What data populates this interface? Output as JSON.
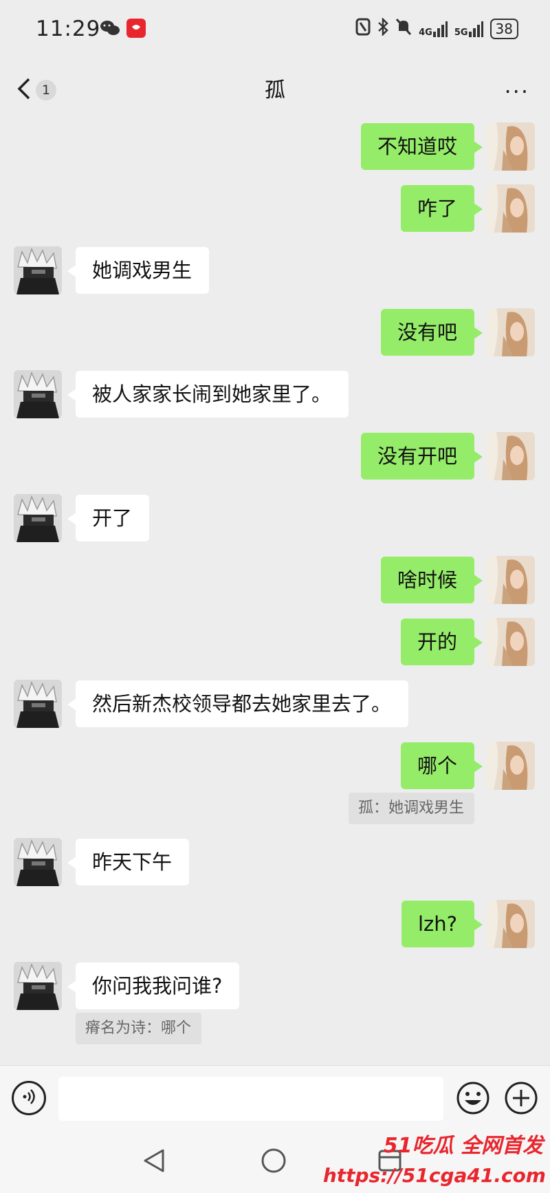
{
  "status_bar": {
    "time": "11:29",
    "network_4g": "4G",
    "network_5g": "5G",
    "battery": "38"
  },
  "header": {
    "back_badge": "1",
    "title": "孤",
    "more": "···"
  },
  "messages": [
    {
      "side": "me",
      "text": "不知道哎"
    },
    {
      "side": "me",
      "text": "咋了"
    },
    {
      "side": "them",
      "text": "她调戏男生"
    },
    {
      "side": "me",
      "text": "没有吧"
    },
    {
      "side": "them",
      "text": "被人家家长闹到她家里了。"
    },
    {
      "side": "me",
      "text": "没有开吧"
    },
    {
      "side": "them",
      "text": "开了"
    },
    {
      "side": "me",
      "text": "啥时候"
    },
    {
      "side": "me",
      "text": "开的"
    },
    {
      "side": "them",
      "text": "然后新杰校领导都去她家里去了。"
    },
    {
      "side": "me",
      "text": "哪个",
      "quote": "孤：她调戏男生"
    },
    {
      "side": "them",
      "text": "昨天下午"
    },
    {
      "side": "me",
      "text": "lzh?"
    },
    {
      "side": "them",
      "text": "你问我我问谁?",
      "quote": "瘠名为诗：哪个"
    }
  ],
  "input_bar": {
    "placeholder": ""
  },
  "watermark": {
    "brand": "51吃瓜 全网首发",
    "url": "https://51cga41.com"
  },
  "colors": {
    "my_bubble": "#95ec69",
    "their_bubble": "#ffffff",
    "background": "#ededed",
    "watermark": "#e8262e"
  }
}
